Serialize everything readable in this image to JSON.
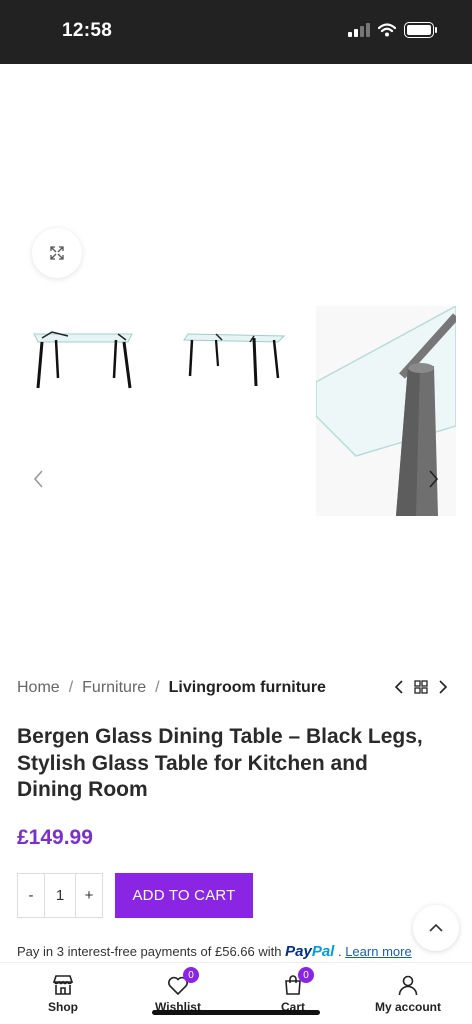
{
  "status_bar": {
    "time": "12:58"
  },
  "breadcrumb": {
    "items": [
      "Home",
      "Furniture",
      "Livingroom furniture"
    ],
    "separator": "/"
  },
  "product": {
    "title": "Bergen Glass Dining Table – Black Legs, Stylish Glass Table for Kitchen and Dining Room",
    "price": "£149.99",
    "quantity": "1",
    "qty_minus": "-",
    "qty_plus": "+",
    "add_to_cart_label": "ADD TO CART"
  },
  "paypal": {
    "text": "Pay in 3 interest-free payments of £56.66 with",
    "logo_pay": "Pay",
    "logo_pal": "Pal",
    "suffix": ".",
    "link": "Learn more"
  },
  "bottom_nav": {
    "shop": "Shop",
    "wishlist": "Wishlist",
    "wishlist_count": "0",
    "cart": "Cart",
    "cart_count": "0",
    "account": "My account"
  },
  "colors": {
    "accent": "#8a25e4",
    "price": "#7b2fd0",
    "status_bar": "#222222"
  }
}
